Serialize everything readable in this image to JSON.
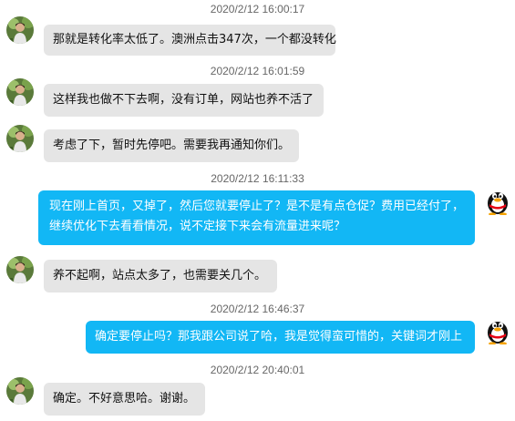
{
  "messages": [
    {
      "timestamp": "2020/2/12 16:00:17",
      "side": "in",
      "text": "那就是转化率太低了。澳洲点击347次，一个都没转化"
    },
    {
      "timestamp": "2020/2/12 16:01:59",
      "side": "in",
      "text": "这样我也做不下去啊，没有订单，网站也养不活了"
    },
    {
      "timestamp": "",
      "side": "in",
      "text": "考虑了下，暂时先停吧。需要我再通知你们。"
    },
    {
      "timestamp": "2020/2/12 16:11:33",
      "side": "out",
      "lines": [
        "现在刚上首页，又掉了，然后您就要停止了？是不是有点仓促？费用已经付了，",
        "继续优化下去看看情况，说不定接下来会有流量进来呢？"
      ]
    },
    {
      "timestamp": "",
      "side": "in",
      "text": "养不起啊，站点太多了，也需要关几个。"
    },
    {
      "timestamp": "2020/2/12 16:46:37",
      "side": "out",
      "text": "确定要停止吗？那我跟公司说了哈，我是觉得蛮可惜的，关键词才刚上"
    },
    {
      "timestamp": "2020/2/12 20:40:01",
      "side": "in",
      "text": "确定。不好意思哈。谢谢。"
    }
  ],
  "icons": {
    "customer_avatar": "customer-avatar-photo",
    "agent_avatar": "qq-penguin-avatar"
  },
  "colors": {
    "incoming_bubble": "#e5e5e5",
    "outgoing_bubble": "#12b7f5",
    "timestamp_text": "#666666"
  }
}
